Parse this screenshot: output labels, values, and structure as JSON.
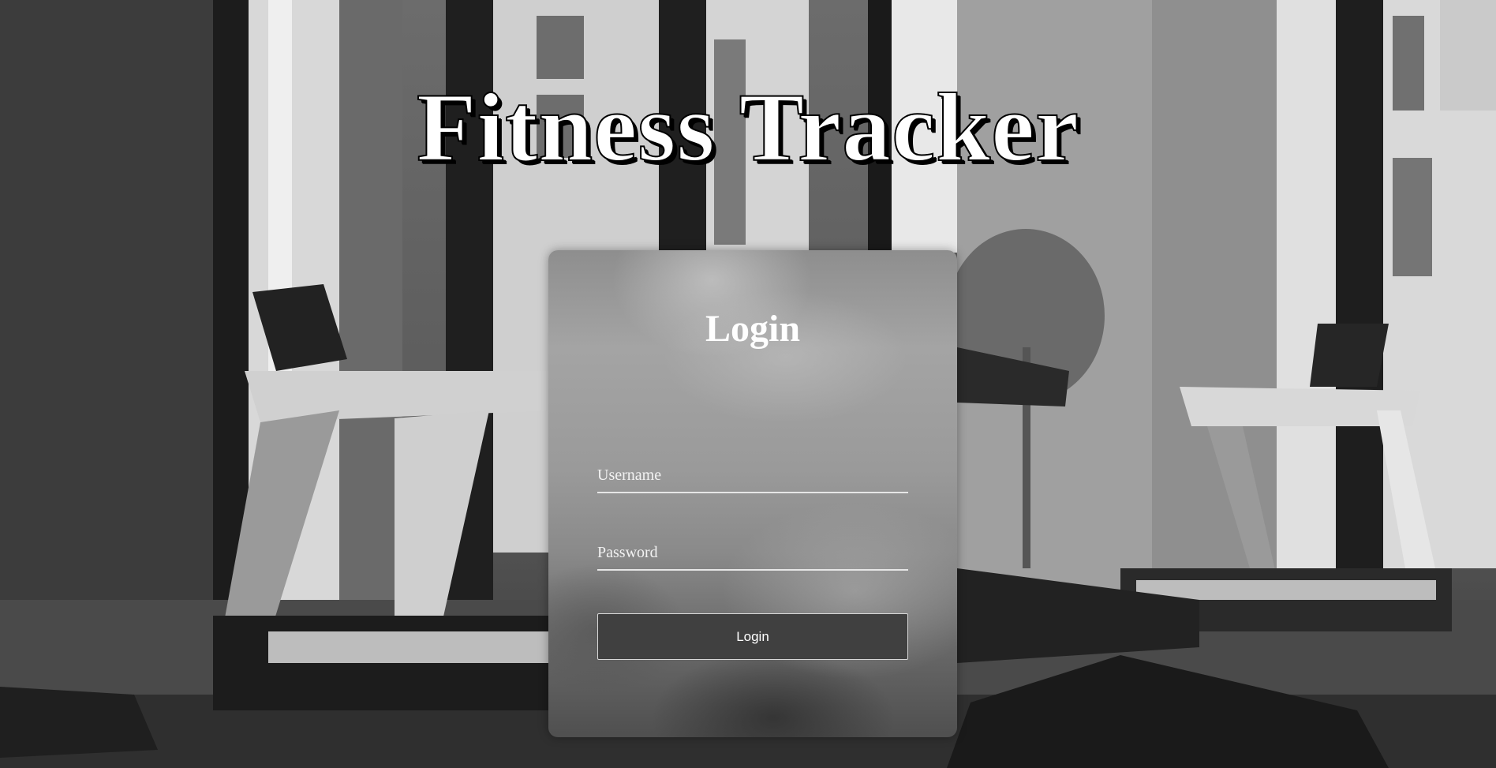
{
  "app": {
    "title": "Fitness Tracker"
  },
  "login_form": {
    "heading": "Login",
    "username": {
      "value": "",
      "placeholder": "Username"
    },
    "password": {
      "value": "",
      "placeholder": "Password"
    },
    "submit_label": "Login"
  },
  "theme": {
    "title_color": "#ffffff",
    "button_bg": "#404040",
    "card_tint": "#9a9a9a"
  }
}
